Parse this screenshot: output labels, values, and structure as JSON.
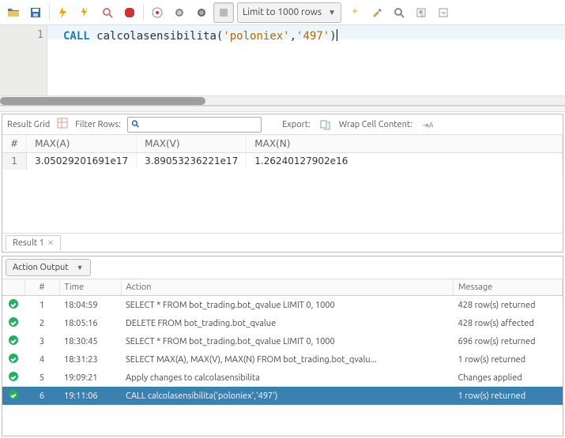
{
  "toolbar": {
    "limit_label": "Limit to 1000 rows"
  },
  "editor": {
    "line_number": "1",
    "code": {
      "kw": "CALL",
      "ident": "calcolasensibilita",
      "open": "(",
      "arg1": "'poloniex'",
      "comma": ",",
      "arg2": "'497'",
      "close": ")"
    }
  },
  "result": {
    "toolbar": {
      "grid_label": "Result Grid",
      "filter_label": "Filter Rows:",
      "export_label": "Export:",
      "wrap_label": "Wrap Cell Content:"
    },
    "columns": [
      "#",
      "MAX(A)",
      "MAX(V)",
      "MAX(N)"
    ],
    "rows": [
      {
        "n": "1",
        "c": [
          "3.05029201691e17",
          "3.89053236221e17",
          "1.26240127902e16"
        ]
      }
    ],
    "tab_label": "Result 1"
  },
  "action": {
    "dropdown_label": "Action Output",
    "columns": [
      "",
      "#",
      "Time",
      "Action",
      "Message"
    ],
    "rows": [
      {
        "n": "1",
        "time": "18:04:59",
        "action": "SELECT * FROM bot_trading.bot_qvalue LIMIT 0, 1000",
        "msg": "428 row(s) returned"
      },
      {
        "n": "2",
        "time": "18:05:16",
        "action": "DELETE FROM bot_trading.bot_qvalue",
        "msg": "428 row(s) affected"
      },
      {
        "n": "3",
        "time": "18:30:45",
        "action": "SELECT * FROM bot_trading.bot_qvalue LIMIT 0, 1000",
        "msg": "696 row(s) returned"
      },
      {
        "n": "4",
        "time": "18:31:23",
        "action": "SELECT MAX(A), MAX(V), MAX(N) FROM bot_trading.bot_qvalu...",
        "msg": "1 row(s) returned"
      },
      {
        "n": "5",
        "time": "19:09:21",
        "action": "Apply changes to calcolasensibilita",
        "msg": "Changes applied"
      },
      {
        "n": "6",
        "time": "19:11:06",
        "action": "CALL calcolasensibilita('poloniex','497')",
        "msg": "1 row(s) returned"
      }
    ],
    "selected_index": 5
  }
}
